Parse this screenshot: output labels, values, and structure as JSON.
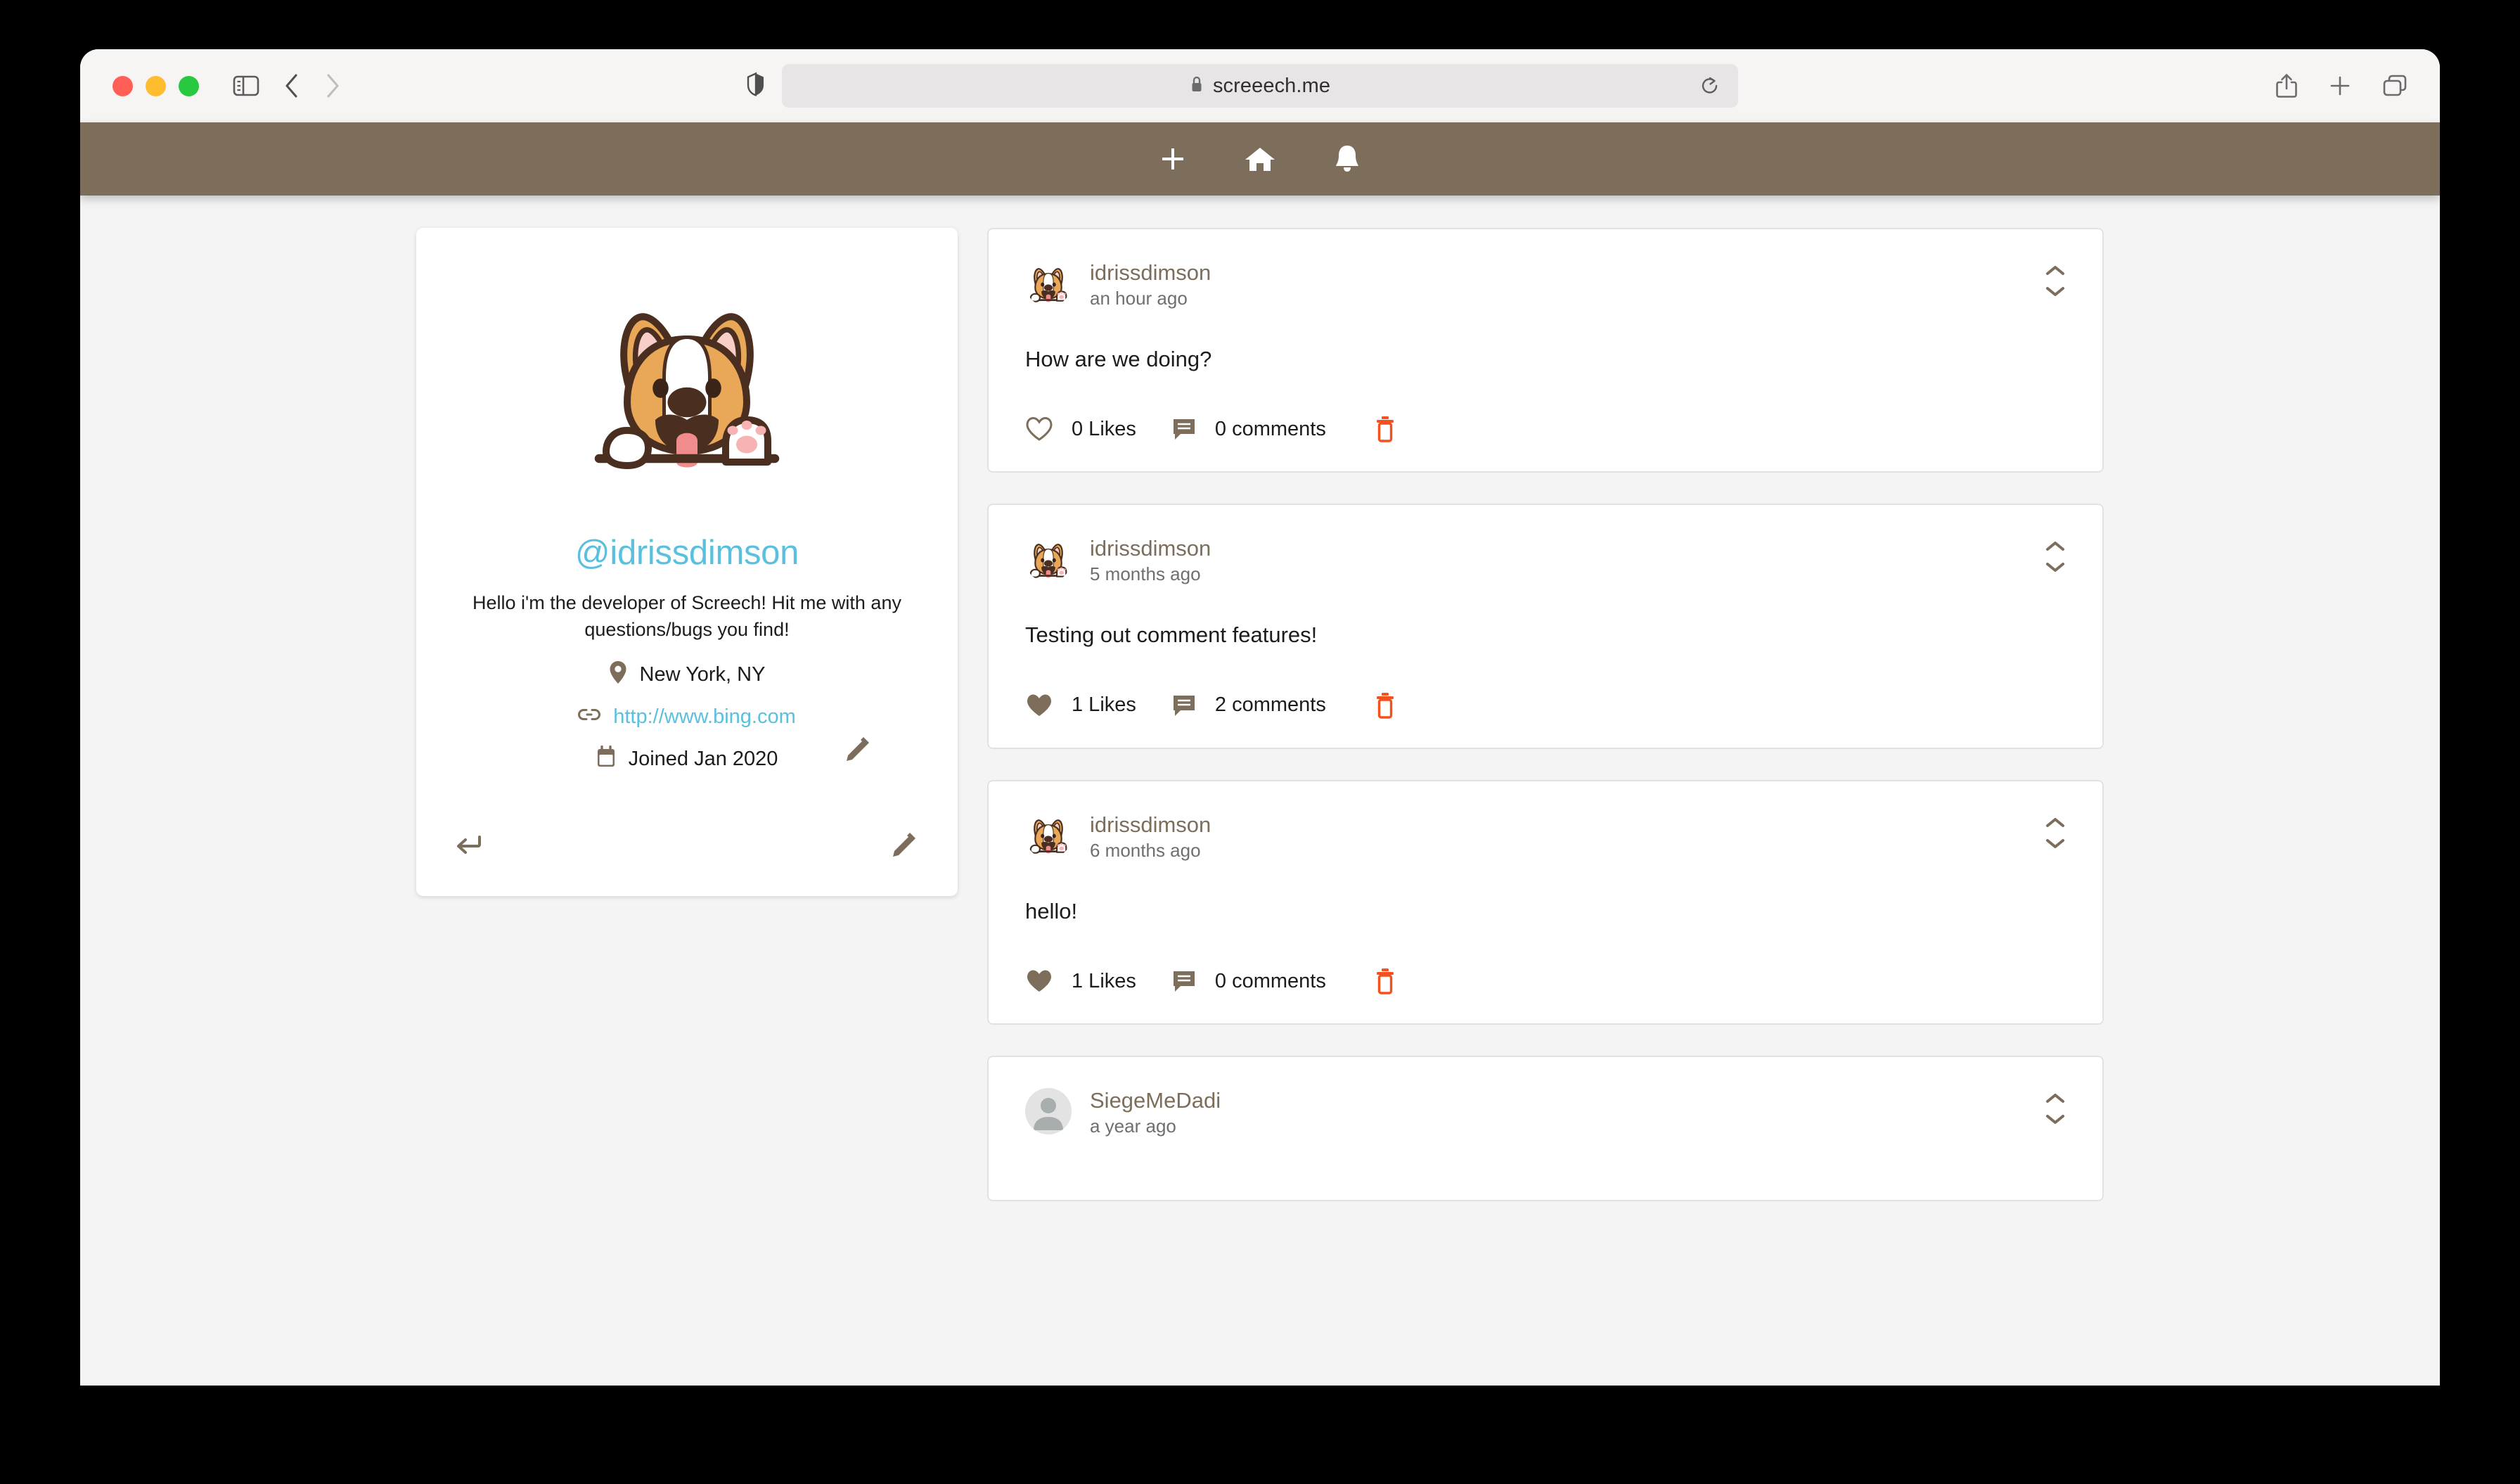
{
  "browser": {
    "address": "screeech.me",
    "traffic_lights": [
      "close",
      "minimize",
      "maximize"
    ],
    "icons": {
      "sidebar": "sidebar-icon",
      "back": "back-arrow-icon",
      "forward": "forward-arrow-icon",
      "shield": "privacy-shield-icon",
      "lock": "lock-icon",
      "reload": "reload-icon",
      "share": "share-icon",
      "new_tab": "plus-icon",
      "tab_overview": "tab-overview-icon"
    }
  },
  "site_nav": {
    "background": "#7d6e5b",
    "items": [
      {
        "name": "create-post",
        "icon": "plus-icon"
      },
      {
        "name": "home",
        "icon": "home-icon"
      },
      {
        "name": "notifications",
        "icon": "bell-icon"
      }
    ]
  },
  "profile": {
    "handle": "@idrissdimson",
    "bio": "Hello i'm the developer of Screech! Hit me with any questions/bugs you find!",
    "location": "New York, NY",
    "website": "http://www.bing.com",
    "joined": "Joined Jan 2020",
    "avatar": "corgi-avatar",
    "icons": {
      "location": "location-pin-icon",
      "link": "link-icon",
      "calendar": "calendar-icon",
      "edit_avatar": "pencil-icon",
      "back": "back-arrow-icon",
      "edit_profile": "pencil-icon"
    },
    "colors": {
      "handle": "#5bc0de",
      "link": "#5bc0de",
      "accent": "#7d6e5b"
    }
  },
  "feed": {
    "posts": [
      {
        "username": "idrissdimson",
        "time": "an hour ago",
        "text": "How are we doing?",
        "likes": "0 Likes",
        "comments": "0 comments",
        "liked": false,
        "avatar": "corgi-avatar"
      },
      {
        "username": "idrissdimson",
        "time": "5 months ago",
        "text": "Testing out comment features!",
        "likes": "1 Likes",
        "comments": "2 comments",
        "liked": true,
        "avatar": "corgi-avatar"
      },
      {
        "username": "idrissdimson",
        "time": "6 months ago",
        "text": "hello!",
        "likes": "1 Likes",
        "comments": "0 comments",
        "liked": true,
        "avatar": "corgi-avatar"
      },
      {
        "username": "SiegeMeDadi",
        "time": "a year ago",
        "text": "",
        "likes": "",
        "comments": "",
        "liked": false,
        "avatar": "default-avatar"
      }
    ],
    "icons": {
      "like": "heart-icon",
      "comment": "comment-icon",
      "delete": "trash-icon",
      "collapse": "chevron-up-down-icon"
    },
    "colors": {
      "username": "#7d6e5b",
      "delete": "#f4511e",
      "heart": "#7d6e5b"
    }
  }
}
